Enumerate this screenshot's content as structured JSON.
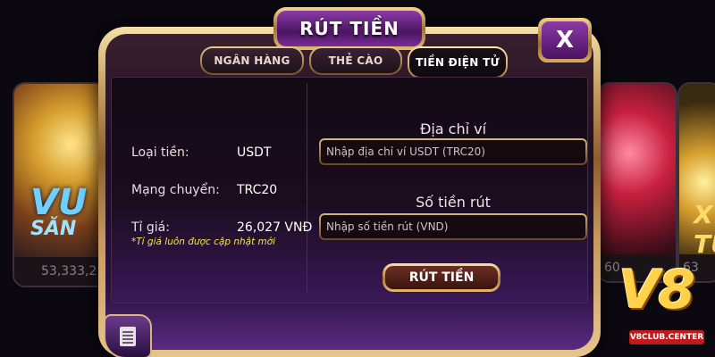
{
  "background": {
    "left_tile": {
      "title_big": "VU",
      "title_small": "SĂN",
      "amount": "53,333,2"
    },
    "right_tile": {
      "amount": "60"
    },
    "far_right_tile": {
      "title": "X\nTU",
      "amount": "63"
    }
  },
  "dialog": {
    "title": "RÚT TIỀN",
    "close_label": "X",
    "tabs": [
      {
        "label": "NGÂN HÀNG",
        "active": false
      },
      {
        "label": "THẺ CÀO",
        "active": false
      },
      {
        "label": "TIỀN ĐIỆN TỬ",
        "active": true
      }
    ],
    "info": {
      "currency_label": "Loại tiền:",
      "currency_value": "USDT",
      "network_label": "Mạng chuyển:",
      "network_value": "TRC20",
      "rate_label": "Tỉ giá:",
      "rate_value": "26,027 VNĐ",
      "rate_note": "*Tỉ giá luôn được cập nhật mới"
    },
    "form": {
      "wallet_label": "Địa chỉ ví",
      "wallet_placeholder": "Nhập địa chỉ ví USDT (TRC20)",
      "wallet_value": "",
      "amount_label": "Số tiền rút",
      "amount_placeholder": "Nhập số tiền rút (VND)",
      "amount_value": "",
      "submit_label": "RÚT TIỀN"
    },
    "history_icon": "document-list-icon"
  },
  "brand": {
    "logo_text": "V8",
    "site": "V8CLUB.CENTER"
  },
  "colors": {
    "gold": "#d8b878",
    "purple": "#4a1660",
    "note_yellow": "#f5e34a"
  }
}
